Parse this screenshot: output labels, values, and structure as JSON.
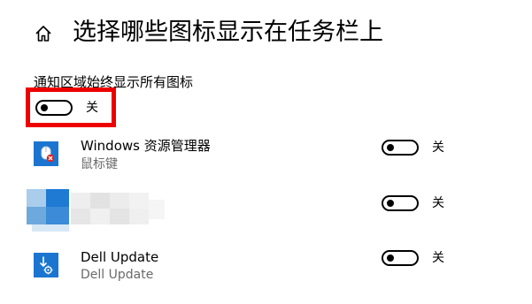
{
  "header": {
    "home_icon": "home-icon",
    "title": "选择哪些图标显示在任务栏上"
  },
  "always_show": {
    "label": "通知区域始终显示所有图标",
    "state_text": "关",
    "on": false,
    "highlight_color": "#ee0000"
  },
  "apps": [
    {
      "name": "Windows 资源管理器",
      "subtitle": "鼠标键",
      "icon": "mouse-keys-icon",
      "state_text": "关",
      "on": false
    },
    {
      "name": "",
      "subtitle": "",
      "icon": "blurred-app-icon",
      "state_text": "关",
      "on": false
    },
    {
      "name": "Dell Update",
      "subtitle": "Dell Update",
      "icon": "dell-update-icon",
      "state_text": "关",
      "on": false
    }
  ],
  "colors": {
    "accent_blue": "#1b75d0",
    "subtitle_gray": "#6a6a6a"
  }
}
